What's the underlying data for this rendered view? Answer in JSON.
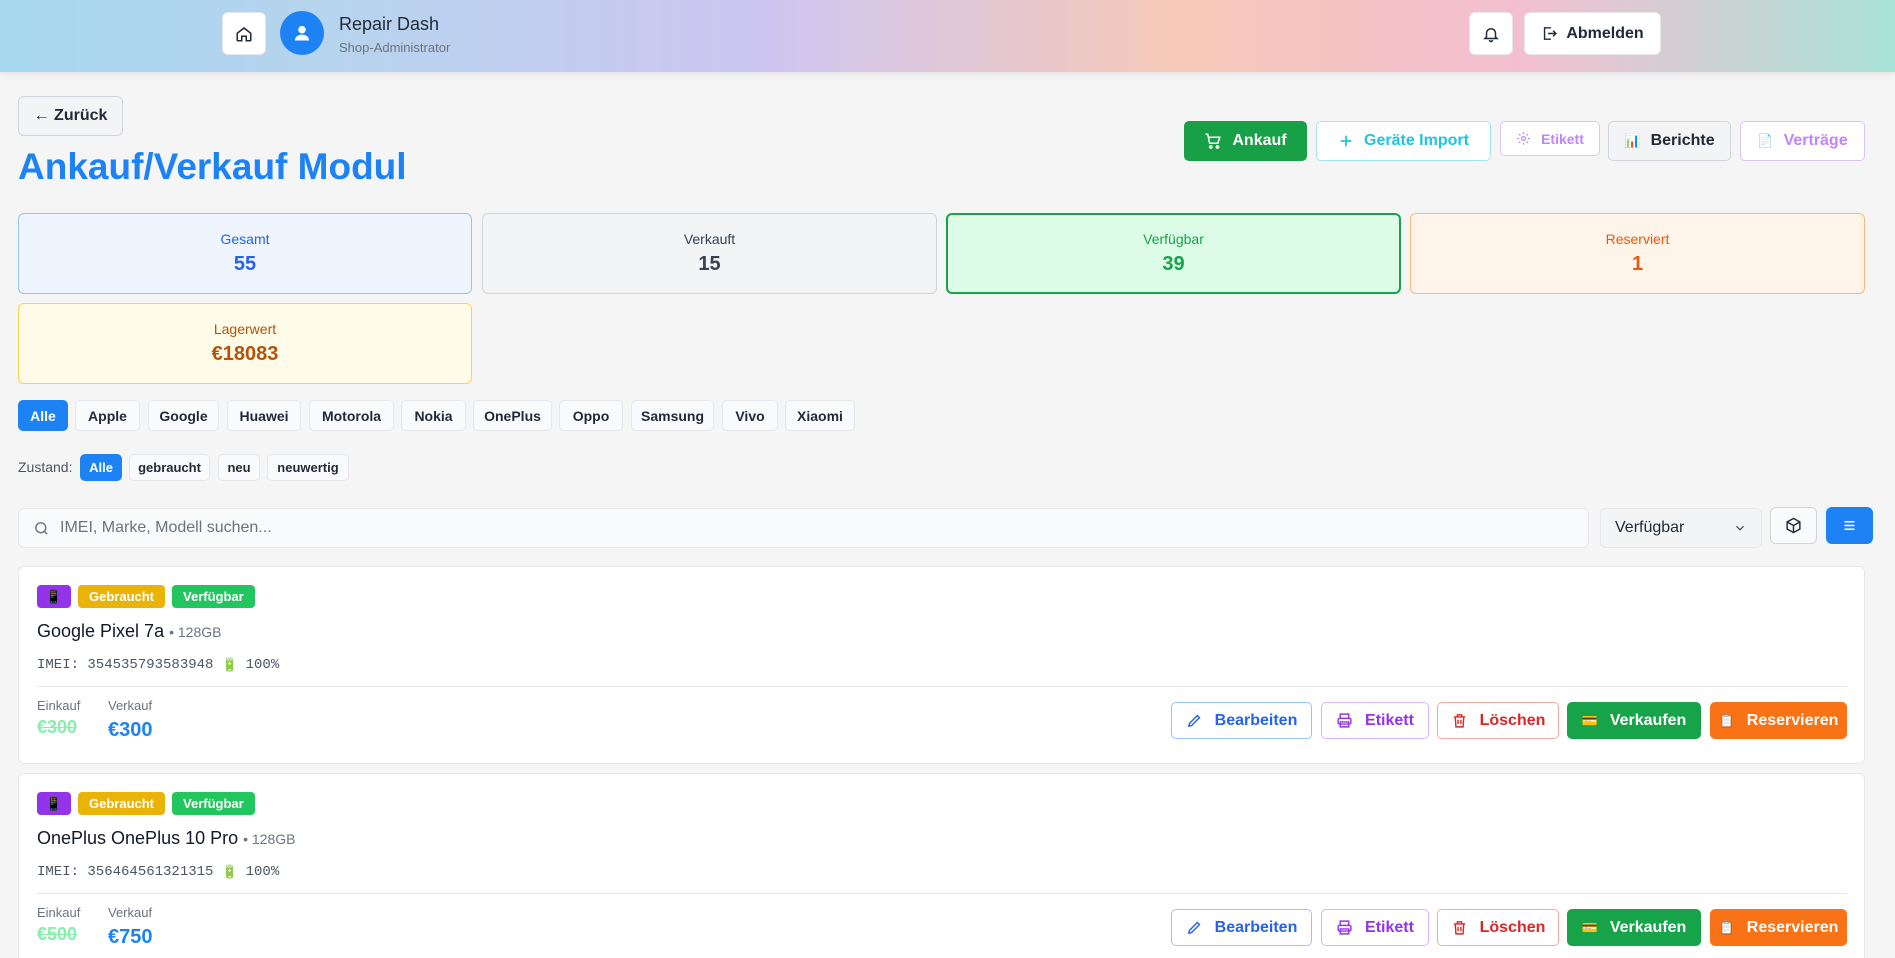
{
  "header": {
    "icons": {
      "home": "home-icon",
      "avatar": "user-icon",
      "notifications": "bell-icon",
      "logout": "logout-icon"
    },
    "app_title": "Repair Dash",
    "role": "Shop-Administrator",
    "logout_label": "Abmelden"
  },
  "page": {
    "back_label": "← Zurück",
    "title": "Ankauf/Verkauf Modul"
  },
  "toolbar": {
    "ankauf_label": "Ankauf",
    "import_label": "Geräte Import",
    "etikett_label": "Etikett",
    "berichte_label": "Berichte",
    "vertrage_label": "Verträge"
  },
  "stats": {
    "total": {
      "label": "Gesamt",
      "value": "55"
    },
    "sold": {
      "label": "Verkauft",
      "value": "15"
    },
    "available": {
      "label": "Verfügbar",
      "value": "39"
    },
    "reserved": {
      "label": "Reserviert",
      "value": "1"
    },
    "stock_value": {
      "label": "Lagerwert",
      "value": "€18083"
    }
  },
  "brand_filters": [
    "Alle",
    "Apple",
    "Google",
    "Huawei",
    "Motorola",
    "Nokia",
    "OnePlus",
    "Oppo",
    "Samsung",
    "Vivo",
    "Xiaomi"
  ],
  "condition_filter": {
    "label": "Zustand:",
    "options": [
      "Alle",
      "gebraucht",
      "neu",
      "neuwertig"
    ]
  },
  "search": {
    "placeholder": "IMEI, Marke, Modell suchen...",
    "status_select": "Verfügbar"
  },
  "devices": [
    {
      "condition": "Gebraucht",
      "status": "Verfügbar",
      "name": "Google Pixel 7a",
      "storage": "• 128GB",
      "imei": "IMEI: 354535793583948",
      "battery": "100%",
      "purchase_label": "Einkauf",
      "purchase_price": "€300",
      "sale_label": "Verkauf",
      "sale_price": "€300"
    },
    {
      "condition": "Gebraucht",
      "status": "Verfügbar",
      "name": "OnePlus OnePlus 10 Pro",
      "storage": "• 128GB",
      "imei": "IMEI: 356464561321315",
      "battery": "100%",
      "purchase_label": "Einkauf",
      "purchase_price": "€500",
      "sale_label": "Verkauf",
      "sale_price": "€750"
    }
  ],
  "actions": {
    "edit": "Bearbeiten",
    "label": "Etikett",
    "delete": "Löschen",
    "sell": "Verkaufen",
    "reserve": "Reservieren"
  },
  "colors": {
    "primary": "#1d83f5",
    "success": "#16a34a",
    "warning": "#f97316",
    "danger": "#dc2626"
  }
}
